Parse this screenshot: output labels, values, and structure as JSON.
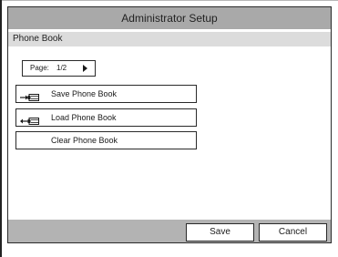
{
  "window": {
    "title": "Administrator Setup"
  },
  "section": {
    "title": "Phone Book"
  },
  "pager": {
    "label": "Page:",
    "value": "1/2",
    "arrow_icon": "triangle-right-icon"
  },
  "actions": [
    {
      "label": "Save Phone Book",
      "icon": "export-to-card-icon"
    },
    {
      "label": "Load Phone Book",
      "icon": "import-from-card-icon"
    },
    {
      "label": "Clear Phone Book"
    }
  ],
  "footer": {
    "save_label": "Save",
    "cancel_label": "Cancel"
  },
  "colors": {
    "titlebar": "#a9a9a9",
    "subheader": "#dcdcdc",
    "footer": "#b3b3b3"
  }
}
